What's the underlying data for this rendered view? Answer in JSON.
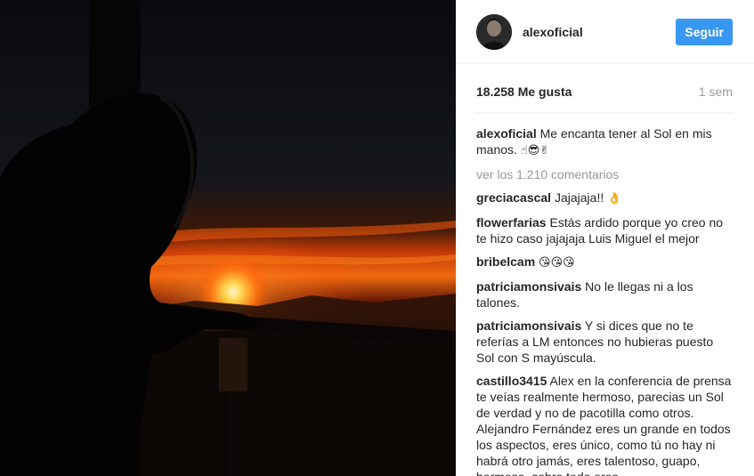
{
  "header": {
    "username": "alexoficial",
    "follow_label": "Seguir"
  },
  "stats": {
    "likes": "18.258 Me gusta",
    "time": "1 sem"
  },
  "caption": {
    "user": "alexoficial",
    "text": "Me encanta tener al Sol en mis manos.",
    "emoji": "☝😎✌"
  },
  "view_more": "ver los 1.210 comentarios",
  "comments": [
    {
      "user": "greciacascal",
      "text": "Jajajaja!!",
      "emoji": "👌"
    },
    {
      "user": "flowerfarias",
      "text": "Estás ardido porque yo creo no te hizo caso jajajaja Luis Miguel el mejor",
      "emoji": ""
    },
    {
      "user": "bribelcam",
      "text": "",
      "emoji": "😘😘😘"
    },
    {
      "user": "patriciamonsivais",
      "text": "No le llegas ni a los talones.",
      "emoji": ""
    },
    {
      "user": "patriciamonsivais",
      "text": "Y si dices que no te referías a LM entonces no hubieras puesto Sol con S mayúscula.",
      "emoji": ""
    },
    {
      "user": "castillo3415",
      "text": "Alex en la conferencia de prensa te veías realmente hermoso, parecias un Sol de verdad y no de pacotilla como otros. Alejandro Fernández eres un grande en todos los aspectos, eres único, como tú no hay ni habrá otro jamás, eres talentoso, guapo, hermoso, sobre todo eres",
      "emoji": ""
    }
  ],
  "colors": {
    "follow_button": "#3897f0",
    "muted_text": "#999999",
    "primary_text": "#262626"
  }
}
